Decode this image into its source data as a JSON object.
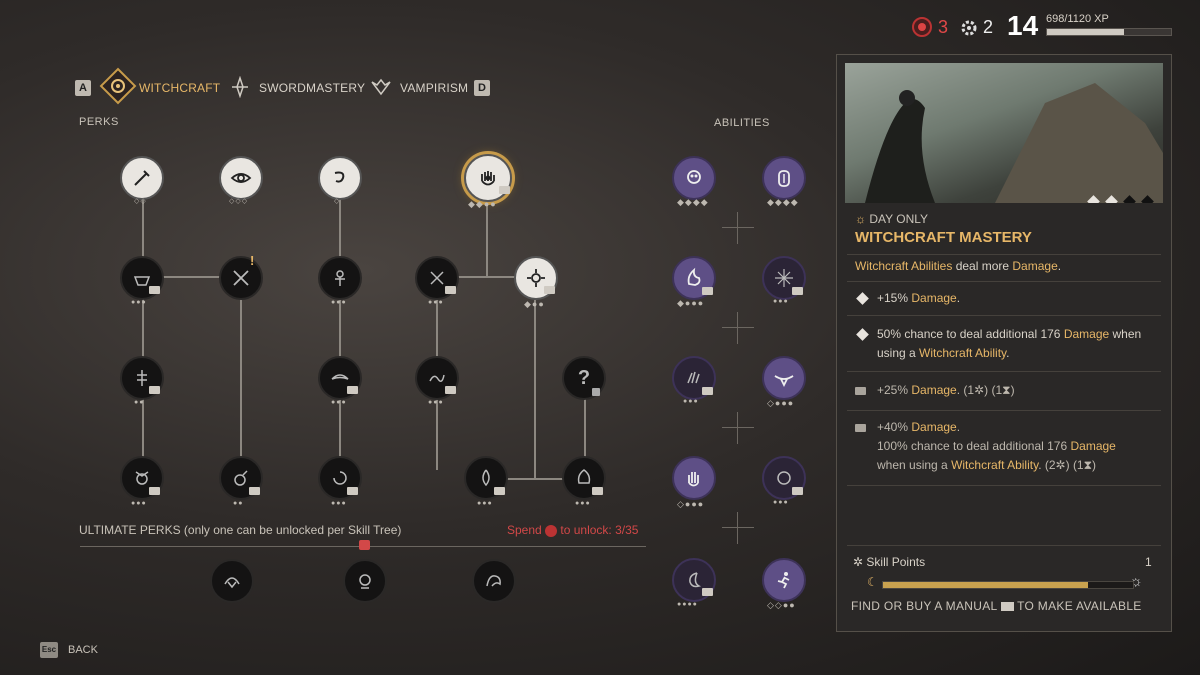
{
  "top": {
    "blood_count": "3",
    "gear_count": "2",
    "level": "14",
    "xp": "698/1120 XP",
    "xp_fraction": 0.623
  },
  "tabs": {
    "left_key": "A",
    "right_key": "D",
    "items": [
      "WITCHCRAFT",
      "SWORDMASTERY",
      "VAMPIRISM"
    ]
  },
  "perks_label": "PERKS",
  "abilities_label": "ABILITIES",
  "ultimate": {
    "label": "ULTIMATE PERKS (only one can be unlocked per Skill Tree)",
    "spend_prefix": "Spend",
    "spend_suffix": "to unlock: 3/35"
  },
  "back": {
    "key": "Esc",
    "label": "BACK"
  },
  "panel": {
    "tag": "DAY ONLY",
    "title": "WITCHCRAFT MASTERY",
    "desc_a": "Witchcraft Abilities",
    "desc_b": " deal more ",
    "desc_c": "Damage",
    "desc_d": ".",
    "r1_a": "+15% ",
    "r1_b": "Damage",
    "r1_c": ".",
    "r2_a": "50% chance to deal additional 176 ",
    "r2_b": "Damage",
    "r2_c": " when",
    "r2_d": "using a ",
    "r2_e": "Witchcraft Ability",
    "r2_f": ".",
    "r3_a": "+25% ",
    "r3_b": "Damage",
    "r3_c": ".  (1",
    "r3_d": ") (1",
    "r3_e": ")",
    "r4_a": "+40% ",
    "r4_b": "Damage",
    "r4_c": ".",
    "r4_d": "100% chance to deal additional 176 ",
    "r4_e": "Damage",
    "r4_f": "when using a ",
    "r4_g": "Witchcraft Ability",
    "r4_h": ".  (2",
    "r4_i": ") (1",
    "r4_j": ")",
    "skill_points_label": "Skill Points",
    "skill_points_value": "1",
    "skill_fraction": 0.82,
    "footer_a": "FIND OR BUY A MANUAL",
    "footer_b": "TO MAKE AVAILABLE"
  }
}
